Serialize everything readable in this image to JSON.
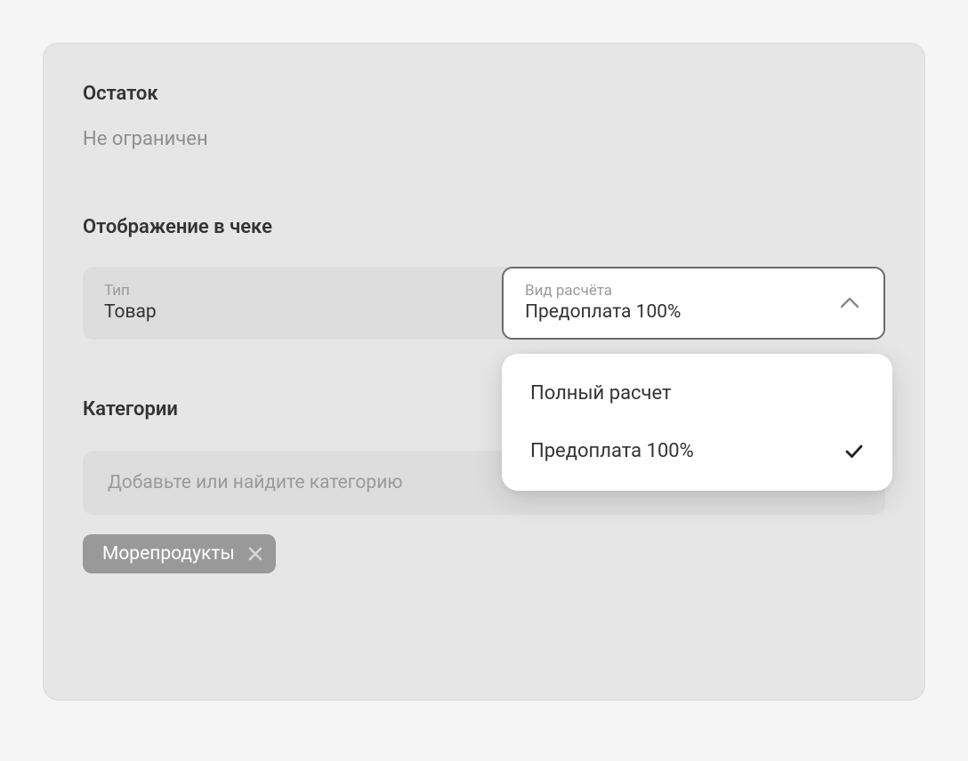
{
  "balance": {
    "title": "Остаток",
    "value": "Не ограничен"
  },
  "receipt_display": {
    "title": "Отображение в чеке",
    "type_select": {
      "label": "Тип",
      "value": "Товар"
    },
    "payment_select": {
      "label": "Вид расчёта",
      "value": "Предоплата 100%",
      "options": [
        {
          "label": "Полный расчет",
          "selected": false
        },
        {
          "label": "Предоплата 100%",
          "selected": true
        }
      ]
    }
  },
  "categories": {
    "title": "Категории",
    "placeholder": "Добавьте или найдите категорию",
    "tags": [
      {
        "label": "Морепродукты"
      }
    ]
  }
}
